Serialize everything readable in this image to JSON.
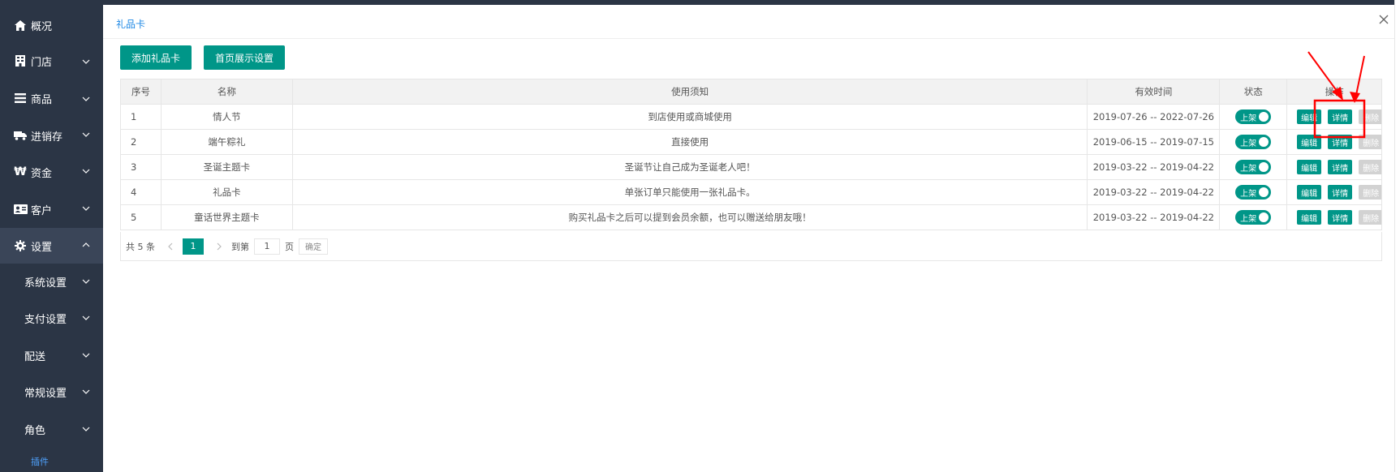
{
  "sidebar": {
    "items": [
      {
        "label": "概况",
        "icon": "home-icon"
      },
      {
        "label": "门店",
        "icon": "building-icon"
      },
      {
        "label": "商品",
        "icon": "list-icon"
      },
      {
        "label": "进销存",
        "icon": "truck-icon"
      },
      {
        "label": "资金",
        "icon": "won-icon"
      },
      {
        "label": "客户",
        "icon": "id-card-icon"
      },
      {
        "label": "设置",
        "icon": "gear-icon"
      }
    ],
    "sub_items": [
      {
        "label": "系统设置"
      },
      {
        "label": "支付设置"
      },
      {
        "label": "配送"
      },
      {
        "label": "常规设置"
      },
      {
        "label": "角色"
      }
    ],
    "plugin_label": "插件"
  },
  "modal": {
    "title": "礼品卡",
    "add_button": "添加礼品卡",
    "home_display_button": "首页展示设置"
  },
  "table": {
    "headers": [
      "序号",
      "名称",
      "使用须知",
      "有效时间",
      "状态",
      "操作"
    ],
    "rows": [
      {
        "index": "1",
        "name": "情人节",
        "notice": "到店使用或商城使用",
        "period": "2019-07-26 -- 2022-07-26",
        "status": "上架"
      },
      {
        "index": "2",
        "name": "端午粽礼",
        "notice": "直接使用",
        "period": "2019-06-15 -- 2019-07-15",
        "status": "上架"
      },
      {
        "index": "3",
        "name": "圣诞主题卡",
        "notice": "圣诞节让自己成为圣诞老人吧！",
        "period": "2019-03-22 -- 2019-04-22",
        "status": "上架"
      },
      {
        "index": "4",
        "name": "礼品卡",
        "notice": "单张订单只能使用一张礼品卡。",
        "period": "2019-03-22 -- 2019-04-22",
        "status": "上架"
      },
      {
        "index": "5",
        "name": "童话世界主题卡",
        "notice": "购买礼品卡之后可以提到会员余额，也可以赠送给朋友哦！",
        "period": "2019-03-22 -- 2019-04-22",
        "status": "上架"
      }
    ],
    "actions": {
      "edit": "编辑",
      "detail": "详情",
      "delete": "删除"
    }
  },
  "pagination": {
    "total": "共 5 条",
    "current_page": "1",
    "goto_label": "到第",
    "page_input": "1",
    "page_suffix": "页",
    "confirm": "确定"
  },
  "colors": {
    "sidebar_bg": "#2b3545",
    "primary": "#009688",
    "title_blue": "#1e88e5",
    "annotation_red": "#ff0000"
  }
}
